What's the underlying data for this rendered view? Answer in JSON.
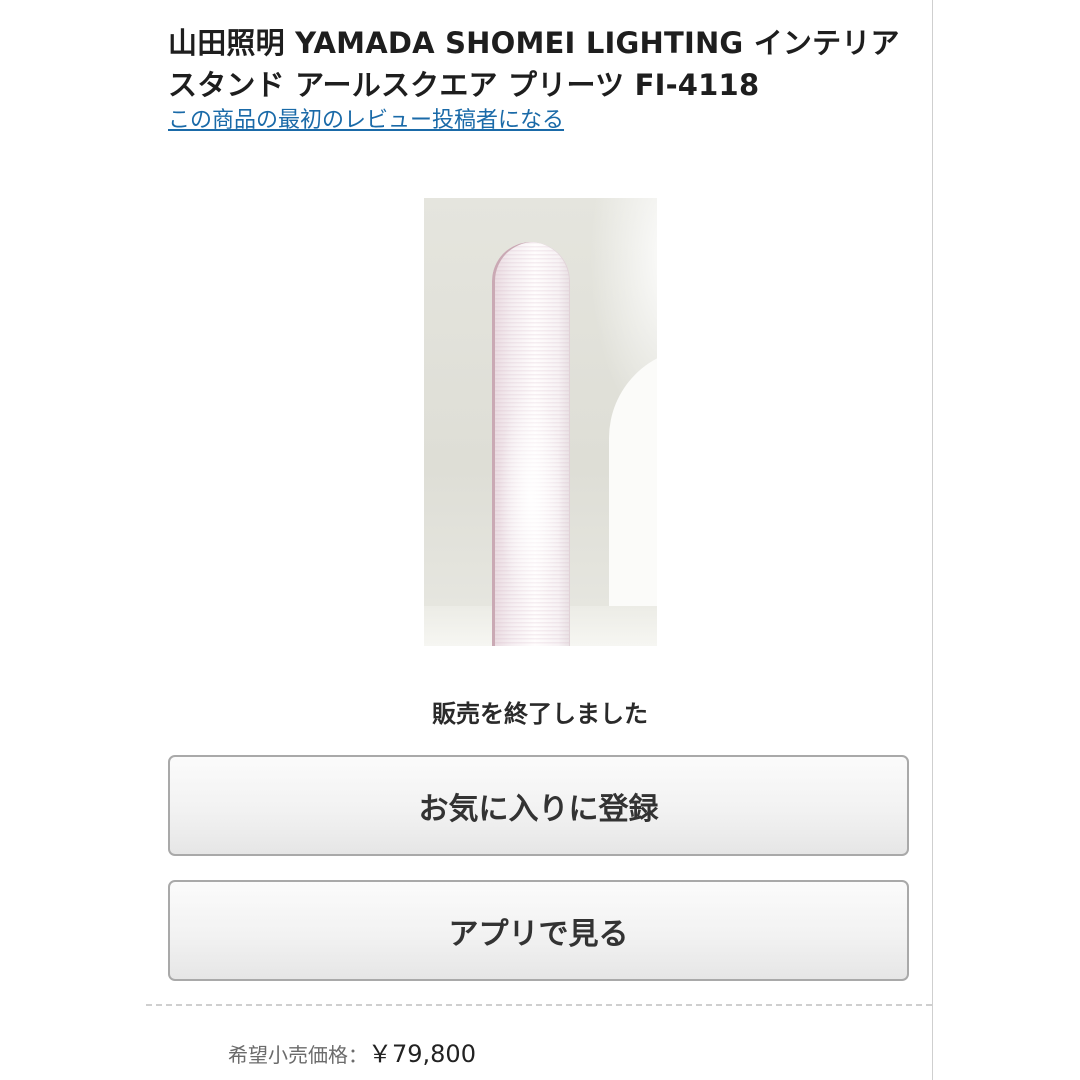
{
  "product": {
    "title": "山田照明 YAMADA SHOMEI LIGHTING インテリアスタンド アールスクエア プリーツ FI-4118",
    "review_link": "この商品の最初のレビュー投稿者になる",
    "status": "販売を終了しました"
  },
  "buttons": {
    "favorite_label": "お気に入りに登録",
    "app_label": "アプリで見る"
  },
  "price": {
    "label": "希望小売価格：",
    "value": "￥79,800"
  },
  "colors": {
    "link": "#1a6aa8",
    "button_border": "#a9a9a9",
    "button_bg": "#f2f2f2"
  }
}
